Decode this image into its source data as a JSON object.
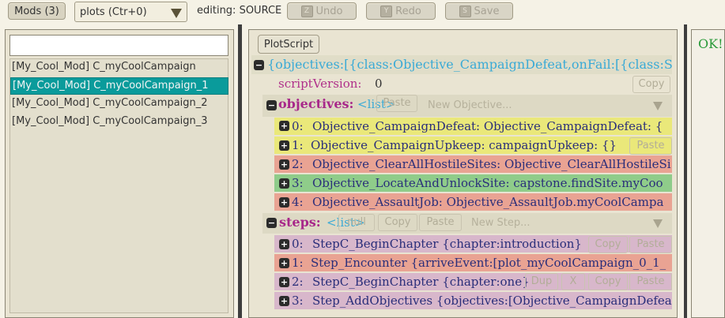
{
  "toolbar": {
    "mods_label": "Mods (3)",
    "plots_select": "plots (Ctr+0)",
    "editing_label": "editing: SOURCE",
    "undo": {
      "key": "Z",
      "label": "Undo"
    },
    "redo": {
      "key": "Y",
      "label": "Redo"
    },
    "save": {
      "key": "S",
      "label": "Save"
    }
  },
  "left_panel": {
    "search_value": "",
    "items": [
      "[My_Cool_Mod] C_myCoolCampaign",
      "[My_Cool_Mod] C_myCoolCampaign_1",
      "[My_Cool_Mod] C_myCoolCampaign_2",
      "[My_Cool_Mod] C_myCoolCampaign_3"
    ],
    "selected_index": 1
  },
  "center_panel": {
    "plotscript_button": "PlotScript",
    "root_text": "{objectives:[{class:Objective_CampaignDefeat,onFail:[{class:St",
    "script_version": {
      "key": "scriptVersion:",
      "value": "0"
    },
    "objectives": {
      "key": "objectives:",
      "type": "<list>",
      "new_placeholder": "New Objective...",
      "ghost_paste": "Paste",
      "items": [
        {
          "idx": "0:",
          "text": "Objective_CampaignDefeat: Objective_CampaignDefeat: {",
          "color": "#eae87a"
        },
        {
          "idx": "1:",
          "text": "Objective_CampaignUpkeep: campaignUpkeep: {}",
          "color": "#eae87a"
        },
        {
          "idx": "2:",
          "text": "Objective_ClearAllHostileSites: Objective_ClearAllHostileSi",
          "color": "#e9a393"
        },
        {
          "idx": "3:",
          "text": "Objective_LocateAndUnlockSite: capstone.findSite.myCoo",
          "color": "#8fcc8a"
        },
        {
          "idx": "4:",
          "text": "Objective_AssaultJob: Objective_AssaultJob.myCoolCampa",
          "color": "#e9a393"
        }
      ]
    },
    "steps": {
      "key": "steps:",
      "type": "<list>",
      "new_placeholder": "New Step...",
      "ghost_null": "null",
      "ghost_copy": "Copy",
      "ghost_paste": "Paste",
      "ghost_dup": "Dup",
      "ghost_x": "X",
      "items": [
        {
          "idx": "0:",
          "text": "StepC_BeginChapter {chapter:introduction}",
          "color": "#d8b7cb"
        },
        {
          "idx": "1:",
          "text": "Step_Encounter {arriveEvent:[plot_myCoolCampaign_0_1_",
          "color": "#e9a393"
        },
        {
          "idx": "2:",
          "text": "StepC_BeginChapter {chapter:one}",
          "color": "#d8b7cb"
        },
        {
          "idx": "3:",
          "text": "Step_AddObjectives {objectives:[Objective_CampaignDefea",
          "color": "#d8b7cb"
        }
      ]
    }
  },
  "right_panel": {
    "status": "OK!"
  }
}
